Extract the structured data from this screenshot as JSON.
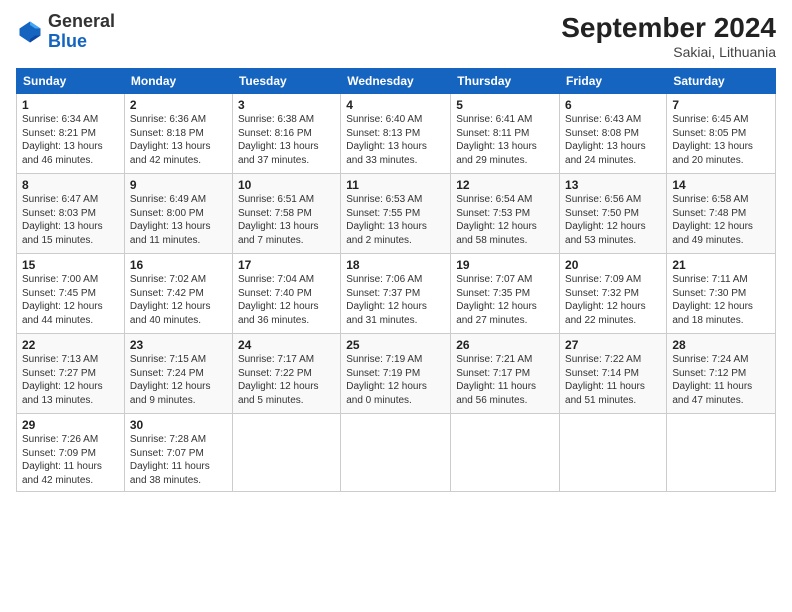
{
  "header": {
    "logo_general": "General",
    "logo_blue": "Blue",
    "title": "September 2024",
    "location": "Sakiai, Lithuania"
  },
  "calendar": {
    "days_of_week": [
      "Sunday",
      "Monday",
      "Tuesday",
      "Wednesday",
      "Thursday",
      "Friday",
      "Saturday"
    ],
    "weeks": [
      [
        {
          "day": "1",
          "info": "Sunrise: 6:34 AM\nSunset: 8:21 PM\nDaylight: 13 hours\nand 46 minutes."
        },
        {
          "day": "2",
          "info": "Sunrise: 6:36 AM\nSunset: 8:18 PM\nDaylight: 13 hours\nand 42 minutes."
        },
        {
          "day": "3",
          "info": "Sunrise: 6:38 AM\nSunset: 8:16 PM\nDaylight: 13 hours\nand 37 minutes."
        },
        {
          "day": "4",
          "info": "Sunrise: 6:40 AM\nSunset: 8:13 PM\nDaylight: 13 hours\nand 33 minutes."
        },
        {
          "day": "5",
          "info": "Sunrise: 6:41 AM\nSunset: 8:11 PM\nDaylight: 13 hours\nand 29 minutes."
        },
        {
          "day": "6",
          "info": "Sunrise: 6:43 AM\nSunset: 8:08 PM\nDaylight: 13 hours\nand 24 minutes."
        },
        {
          "day": "7",
          "info": "Sunrise: 6:45 AM\nSunset: 8:05 PM\nDaylight: 13 hours\nand 20 minutes."
        }
      ],
      [
        {
          "day": "8",
          "info": "Sunrise: 6:47 AM\nSunset: 8:03 PM\nDaylight: 13 hours\nand 15 minutes."
        },
        {
          "day": "9",
          "info": "Sunrise: 6:49 AM\nSunset: 8:00 PM\nDaylight: 13 hours\nand 11 minutes."
        },
        {
          "day": "10",
          "info": "Sunrise: 6:51 AM\nSunset: 7:58 PM\nDaylight: 13 hours\nand 7 minutes."
        },
        {
          "day": "11",
          "info": "Sunrise: 6:53 AM\nSunset: 7:55 PM\nDaylight: 13 hours\nand 2 minutes."
        },
        {
          "day": "12",
          "info": "Sunrise: 6:54 AM\nSunset: 7:53 PM\nDaylight: 12 hours\nand 58 minutes."
        },
        {
          "day": "13",
          "info": "Sunrise: 6:56 AM\nSunset: 7:50 PM\nDaylight: 12 hours\nand 53 minutes."
        },
        {
          "day": "14",
          "info": "Sunrise: 6:58 AM\nSunset: 7:48 PM\nDaylight: 12 hours\nand 49 minutes."
        }
      ],
      [
        {
          "day": "15",
          "info": "Sunrise: 7:00 AM\nSunset: 7:45 PM\nDaylight: 12 hours\nand 44 minutes."
        },
        {
          "day": "16",
          "info": "Sunrise: 7:02 AM\nSunset: 7:42 PM\nDaylight: 12 hours\nand 40 minutes."
        },
        {
          "day": "17",
          "info": "Sunrise: 7:04 AM\nSunset: 7:40 PM\nDaylight: 12 hours\nand 36 minutes."
        },
        {
          "day": "18",
          "info": "Sunrise: 7:06 AM\nSunset: 7:37 PM\nDaylight: 12 hours\nand 31 minutes."
        },
        {
          "day": "19",
          "info": "Sunrise: 7:07 AM\nSunset: 7:35 PM\nDaylight: 12 hours\nand 27 minutes."
        },
        {
          "day": "20",
          "info": "Sunrise: 7:09 AM\nSunset: 7:32 PM\nDaylight: 12 hours\nand 22 minutes."
        },
        {
          "day": "21",
          "info": "Sunrise: 7:11 AM\nSunset: 7:30 PM\nDaylight: 12 hours\nand 18 minutes."
        }
      ],
      [
        {
          "day": "22",
          "info": "Sunrise: 7:13 AM\nSunset: 7:27 PM\nDaylight: 12 hours\nand 13 minutes."
        },
        {
          "day": "23",
          "info": "Sunrise: 7:15 AM\nSunset: 7:24 PM\nDaylight: 12 hours\nand 9 minutes."
        },
        {
          "day": "24",
          "info": "Sunrise: 7:17 AM\nSunset: 7:22 PM\nDaylight: 12 hours\nand 5 minutes."
        },
        {
          "day": "25",
          "info": "Sunrise: 7:19 AM\nSunset: 7:19 PM\nDaylight: 12 hours\nand 0 minutes."
        },
        {
          "day": "26",
          "info": "Sunrise: 7:21 AM\nSunset: 7:17 PM\nDaylight: 11 hours\nand 56 minutes."
        },
        {
          "day": "27",
          "info": "Sunrise: 7:22 AM\nSunset: 7:14 PM\nDaylight: 11 hours\nand 51 minutes."
        },
        {
          "day": "28",
          "info": "Sunrise: 7:24 AM\nSunset: 7:12 PM\nDaylight: 11 hours\nand 47 minutes."
        }
      ],
      [
        {
          "day": "29",
          "info": "Sunrise: 7:26 AM\nSunset: 7:09 PM\nDaylight: 11 hours\nand 42 minutes."
        },
        {
          "day": "30",
          "info": "Sunrise: 7:28 AM\nSunset: 7:07 PM\nDaylight: 11 hours\nand 38 minutes."
        },
        {
          "day": "",
          "info": ""
        },
        {
          "day": "",
          "info": ""
        },
        {
          "day": "",
          "info": ""
        },
        {
          "day": "",
          "info": ""
        },
        {
          "day": "",
          "info": ""
        }
      ]
    ]
  }
}
